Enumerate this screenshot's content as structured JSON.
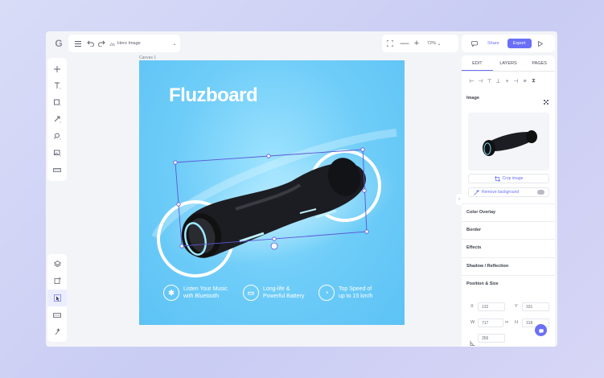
{
  "topbar": {
    "logo": "G",
    "file_name": "Hero Image",
    "zoom": "72%",
    "share_label": "Share",
    "export_label": "Export"
  },
  "left_tools": {
    "top": [
      "add",
      "text",
      "rectangle",
      "line",
      "pen",
      "image",
      "more"
    ],
    "bottom": [
      "layers",
      "frame",
      "select",
      "component",
      "magic"
    ]
  },
  "canvas": {
    "label": "Canvas 1",
    "title": "Fluzboard",
    "features": [
      {
        "icon": "bluetooth-icon",
        "glyph": "✱",
        "line1": "Listen Your Music",
        "line2": "with Bluetooth"
      },
      {
        "icon": "battery-icon",
        "glyph": "▭",
        "line1": "Long-life &",
        "line2": "Powerful Battery"
      },
      {
        "icon": "speed-icon",
        "glyph": "◔",
        "line1": "Top Speed of",
        "line2": "up to 15 km/h"
      }
    ]
  },
  "panel": {
    "tabs": [
      "EDIT",
      "LAYERS",
      "PAGES"
    ],
    "image_heading": "Image",
    "crop_label": "Crop image",
    "remove_bg_label": "Remove background",
    "sections": [
      "Color Overlay",
      "Border",
      "Effects",
      "Shadow / Reflection",
      "Position & Size"
    ],
    "position": {
      "x_label": "X",
      "x": "132",
      "y_label": "Y",
      "y": "331",
      "w_label": "W",
      "w": "717",
      "h_label": "H",
      "h": "318",
      "r": "356"
    }
  },
  "colors": {
    "accent": "#6a6ff7",
    "canvas_bg": "#5cc2f5"
  }
}
